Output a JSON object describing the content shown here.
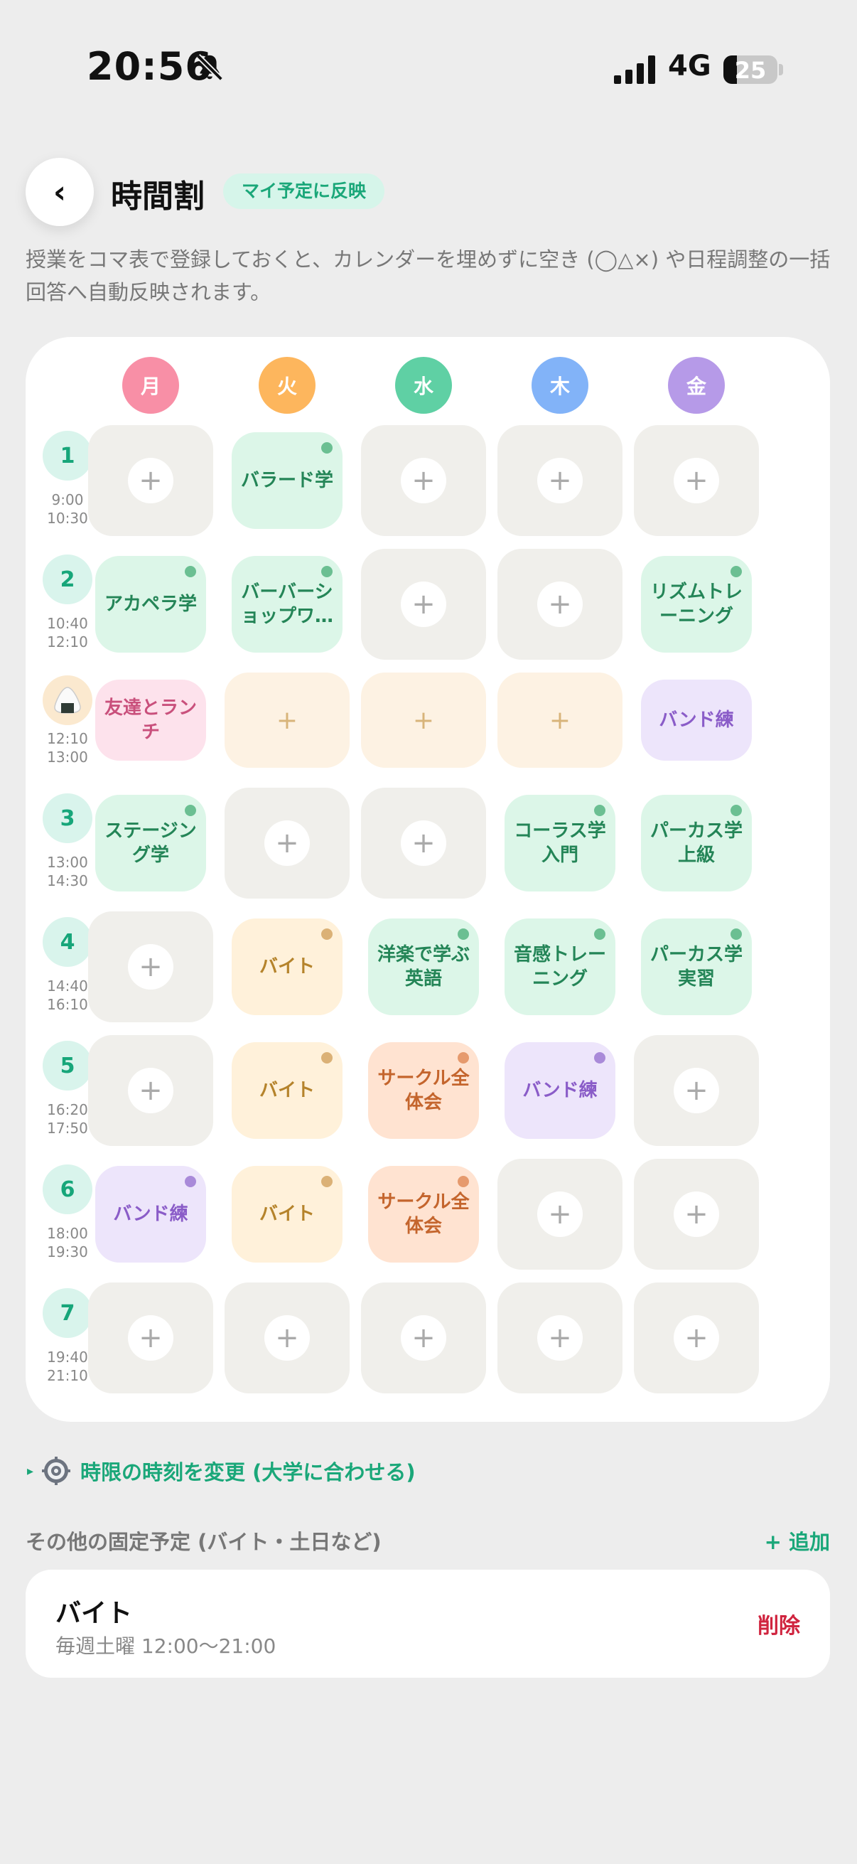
{
  "status_bar": {
    "time": "20:56",
    "network": "4G",
    "battery": "25",
    "battery_level": 0.25
  },
  "header": {
    "back_icon": "‹",
    "title": "時間割",
    "badge": "マイ予定に反映",
    "description": "授業をコマ表で登録しておくと、カレンダーを埋めずに空き (◯△×) や日程調整の一括回答へ自動反映されます。"
  },
  "days": [
    {
      "label": "月",
      "color": "#f88fa6"
    },
    {
      "label": "火",
      "color": "#fdb65d"
    },
    {
      "label": "水",
      "color": "#5fd0a4"
    },
    {
      "label": "木",
      "color": "#82b3f8"
    },
    {
      "label": "金",
      "color": "#b69ae8"
    }
  ],
  "colors": {
    "green": {
      "bg": "#dcf6e8",
      "text": "#248557",
      "dot": "#6bbf92"
    },
    "orange": {
      "bg": "#fff1da",
      "text": "#b5832b",
      "dot": "#dbb176"
    },
    "coral": {
      "bg": "#ffe3d1",
      "text": "#c4652d",
      "dot": "#e69a6d"
    },
    "purple": {
      "bg": "#ede5fb",
      "text": "#8a5cc8",
      "dot": "#a98ad9"
    },
    "pink": {
      "bg": "#fde2ec",
      "text": "#c9507c",
      "dot": "#e88aa9"
    }
  },
  "add_icon": "+",
  "periods": [
    {
      "num": "1",
      "start": "9:00",
      "end": "10:30",
      "cells": [
        null,
        {
          "label": "バラード学",
          "color": "green",
          "dot": true
        },
        null,
        null,
        null
      ]
    },
    {
      "num": "2",
      "start": "10:40",
      "end": "12:10",
      "cells": [
        {
          "label": "アカペラ学",
          "color": "green",
          "dot": true
        },
        {
          "label": "バーバーショップワ…",
          "color": "green",
          "dot": true
        },
        null,
        null,
        {
          "label": "リズムトレーニング",
          "color": "green",
          "dot": true
        }
      ]
    },
    {
      "num": "",
      "lunch": true,
      "icon": "onigiri-icon",
      "start": "12:10",
      "end": "13:00",
      "cells": [
        {
          "label": "友達とランチ",
          "color": "pink",
          "dot": false
        },
        null,
        null,
        null,
        {
          "label": "バンド練",
          "color": "purple",
          "dot": false
        }
      ]
    },
    {
      "num": "3",
      "start": "13:00",
      "end": "14:30",
      "cells": [
        {
          "label": "ステージング学",
          "color": "green",
          "dot": true
        },
        null,
        null,
        {
          "label": "コーラス学入門",
          "color": "green",
          "dot": true
        },
        {
          "label": "パーカス学上級",
          "color": "green",
          "dot": true
        }
      ]
    },
    {
      "num": "4",
      "start": "14:40",
      "end": "16:10",
      "cells": [
        null,
        {
          "label": "バイト",
          "color": "orange",
          "dot": true
        },
        {
          "label": "洋楽で学ぶ英語",
          "color": "green",
          "dot": true
        },
        {
          "label": "音感トレーニング",
          "color": "green",
          "dot": true
        },
        {
          "label": "パーカス学実習",
          "color": "green",
          "dot": true
        }
      ]
    },
    {
      "num": "5",
      "start": "16:20",
      "end": "17:50",
      "cells": [
        null,
        {
          "label": "バイト",
          "color": "orange",
          "dot": true
        },
        {
          "label": "サークル全体会",
          "color": "coral",
          "dot": true
        },
        {
          "label": "バンド練",
          "color": "purple",
          "dot": true
        },
        null
      ]
    },
    {
      "num": "6",
      "start": "18:00",
      "end": "19:30",
      "cells": [
        {
          "label": "バンド練",
          "color": "purple",
          "dot": true
        },
        {
          "label": "バイト",
          "color": "orange",
          "dot": true
        },
        {
          "label": "サークル全体会",
          "color": "coral",
          "dot": true
        },
        null,
        null
      ]
    },
    {
      "num": "7",
      "start": "19:40",
      "end": "21:10",
      "cells": [
        null,
        null,
        null,
        null,
        null
      ]
    }
  ],
  "time_change": {
    "arrow": "▸",
    "label": "時限の時刻を変更 (大学に合わせる)"
  },
  "other_section": {
    "title": "その他の固定予定 (バイト・土日など)",
    "add_label": "+ 追加",
    "items": [
      {
        "name": "バイト",
        "schedule": "毎週土曜 12:00〜21:00",
        "delete_label": "削除"
      }
    ]
  }
}
